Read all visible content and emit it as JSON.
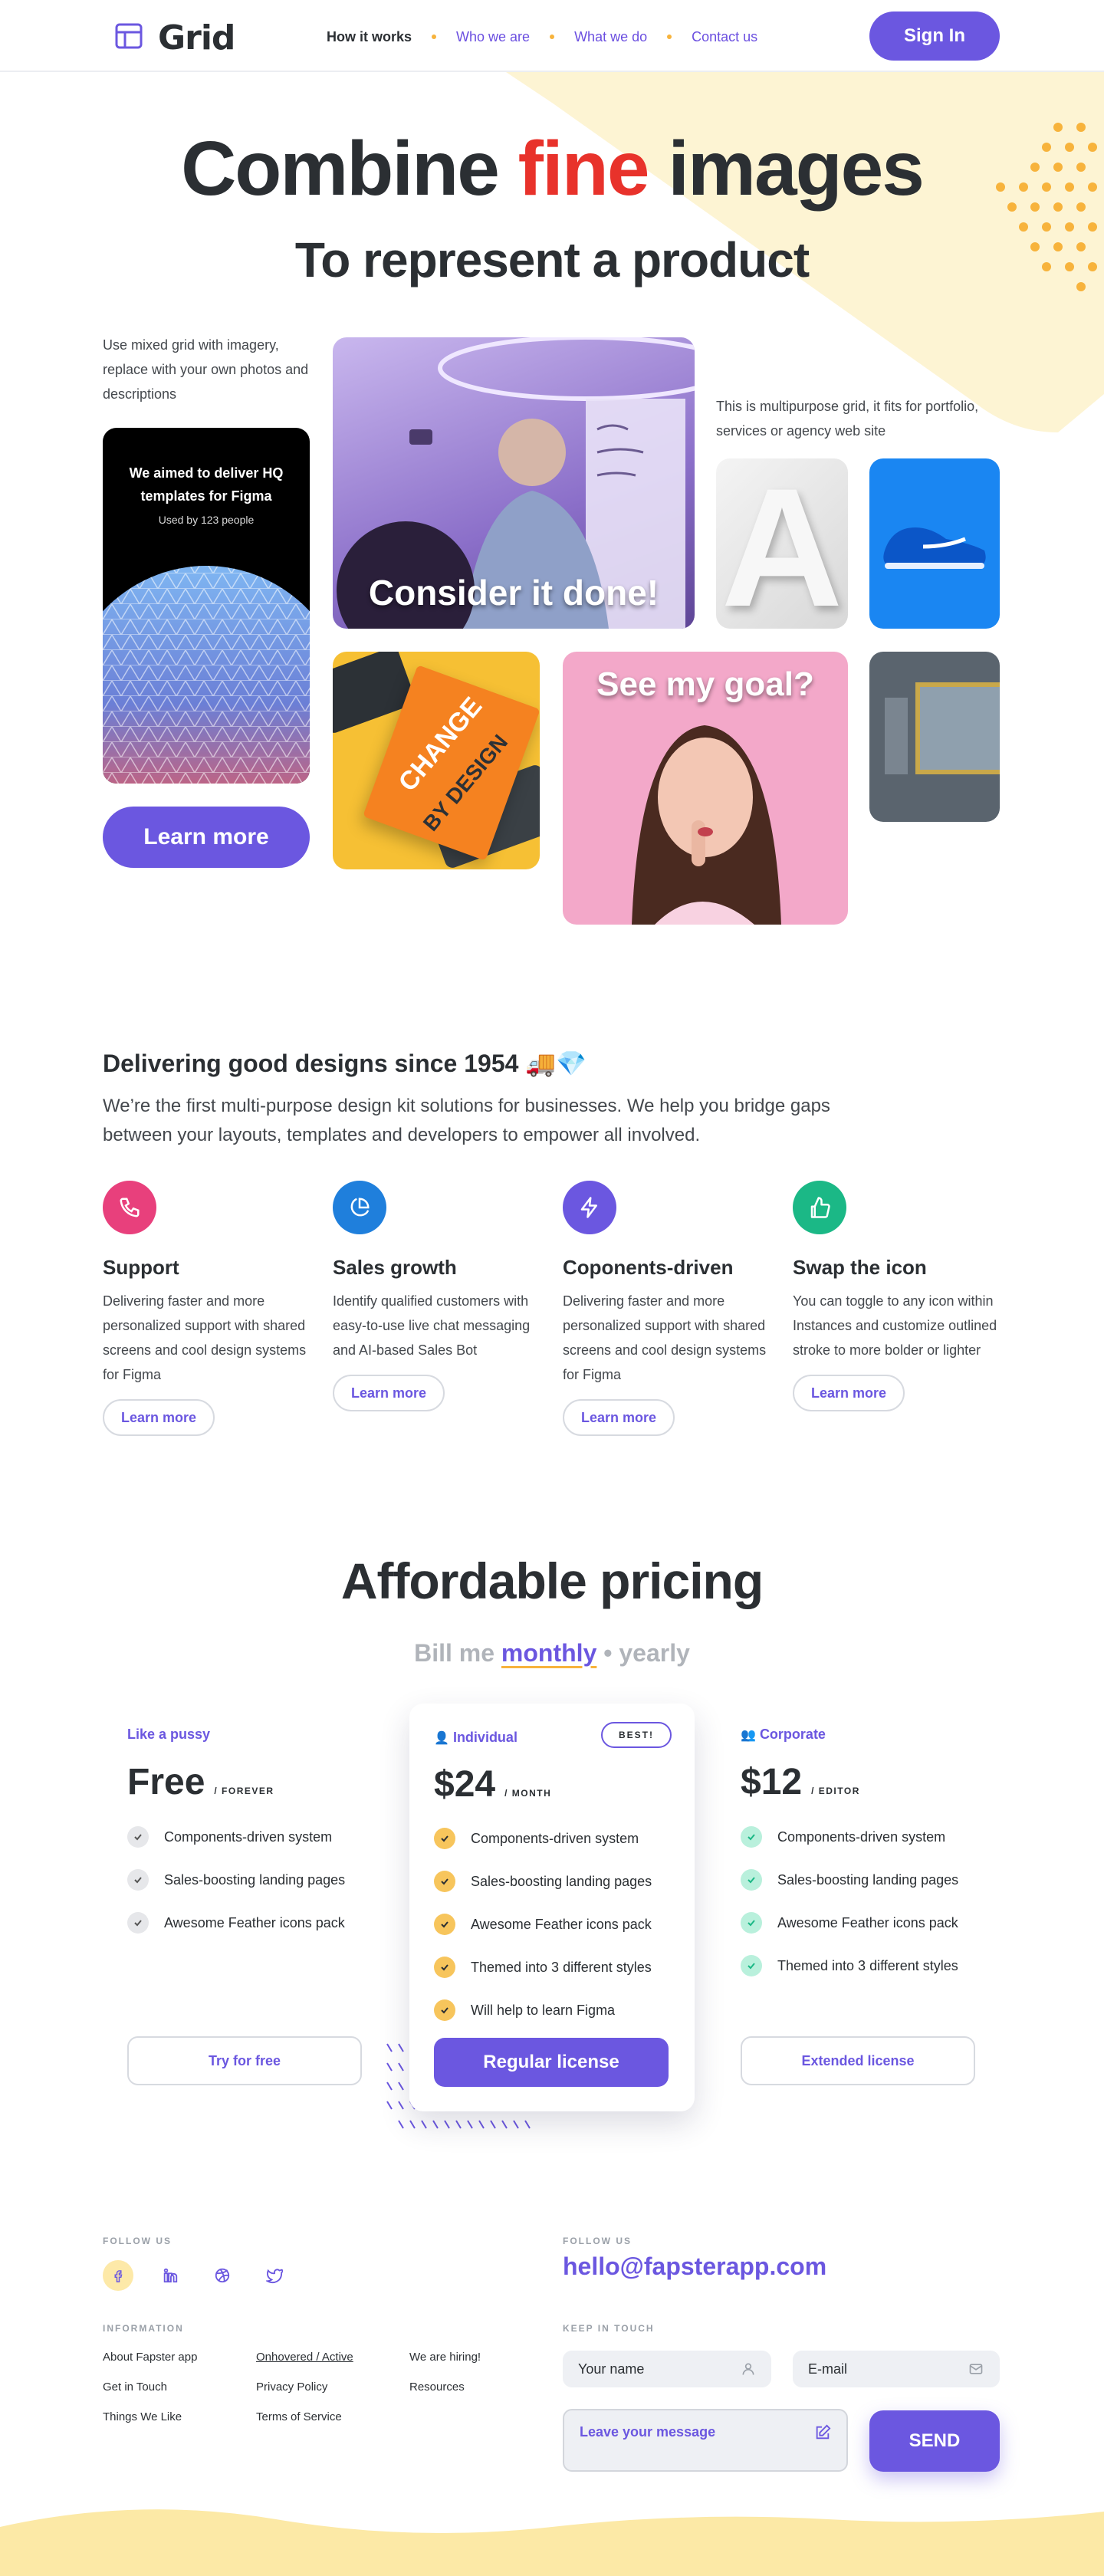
{
  "header": {
    "logo": "Grid",
    "nav": [
      {
        "label": "How it works",
        "active": true
      },
      {
        "label": "Who we are",
        "active": false
      },
      {
        "label": "What we do",
        "active": false
      },
      {
        "label": "Contact us",
        "active": false
      }
    ],
    "signin": "Sign In"
  },
  "hero": {
    "title_before": "Combine",
    "title_highlight": "fine",
    "title_after": "images",
    "subtitle": "To represent a product",
    "left_text": "Use mixed grid with imagery, replace with your own photos and descriptions",
    "right_text": "This is multipurpose grid, it fits for portfolio, services or agency web site",
    "dark_card_title": "We aimed to deliver HQ templates for Figma",
    "dark_card_sub": "Used by 123 people",
    "learn_more": "Learn more",
    "photo1_caption": "Consider it done!",
    "photo2_caption": "See my goal?",
    "book_title_1": "CHANGE",
    "book_title_2": "BY DESIGN",
    "letter": "A"
  },
  "features": {
    "title": "Delivering good designs since 1954 🚚💎",
    "description": "We’re the first multi-purpose design kit solutions for businesses. We help you bridge gaps between your layouts, templates and developers to empower all involved.",
    "items": [
      {
        "icon": "phone-icon",
        "color": "#e8407c",
        "title": "Support",
        "text": "Delivering faster and more personalized support with shared screens and cool design systems for Figma",
        "button": "Learn more"
      },
      {
        "icon": "pie-chart-icon",
        "color": "#1f7fdc",
        "title": "Sales growth",
        "text": "Identify qualified customers with easy-to-use live chat messaging and AI-based Sales Bot",
        "button": "Learn more"
      },
      {
        "icon": "lightning-icon",
        "color": "#6b57e0",
        "title": "Coponents-driven",
        "text": "Delivering faster and more personalized support with shared screens and cool design systems for Figma",
        "button": "Learn more"
      },
      {
        "icon": "thumbs-up-icon",
        "color": "#1bb886",
        "title": "Swap the icon",
        "text": "You can toggle to any icon within Instances and customize outlined stroke to more bolder or lighter",
        "button": "Learn more"
      }
    ]
  },
  "pricing": {
    "title": "Affordable pricing",
    "bill_me": "Bill me",
    "monthly": "monthly",
    "separator": "•",
    "yearly": "yearly",
    "plans": [
      {
        "label": "Like a pussy",
        "price": "Free",
        "period": "/ FOREVER",
        "features": [
          "Components-driven system",
          "Sales-boosting landing pages",
          "Awesome Feather icons pack"
        ],
        "button": "Try for free"
      },
      {
        "label": "Individual",
        "badge": "BEST!",
        "price": "$24",
        "period": "/ MONTH",
        "features": [
          "Components-driven system",
          "Sales-boosting landing pages",
          "Awesome Feather icons pack",
          "Themed into 3 different styles",
          "Will help to learn Figma"
        ],
        "button": "Regular license"
      },
      {
        "label": "Corporate",
        "price": "$12",
        "period": "/ EDITOR",
        "features": [
          "Components-driven system",
          "Sales-boosting landing pages",
          "Awesome Feather icons pack",
          "Themed into 3 different styles"
        ],
        "button": "Extended license"
      }
    ]
  },
  "footer": {
    "follow_us": "FOLLOW US",
    "information": "INFORMATION",
    "follow_us_right": "FOLLOW US",
    "email": "hello@fapsterapp.com",
    "keep_in_touch": "KEEP IN TOUCH",
    "links_col1": [
      "About Fapster app",
      "Get in Touch",
      "Things We Like"
    ],
    "links_col2": [
      "Onhovered / Active",
      "Privacy Policy",
      "Terms of Service"
    ],
    "links_col3": [
      "We are hiring!",
      "Resources"
    ],
    "name_placeholder": "Your name",
    "email_placeholder": "E-mail",
    "message_placeholder": "Leave your message",
    "send": "SEND"
  },
  "colors": {
    "accent": "#6b57e0",
    "highlight": "#e8322b",
    "mint": "#5fe0b4",
    "yellow": "#f7b33c"
  }
}
